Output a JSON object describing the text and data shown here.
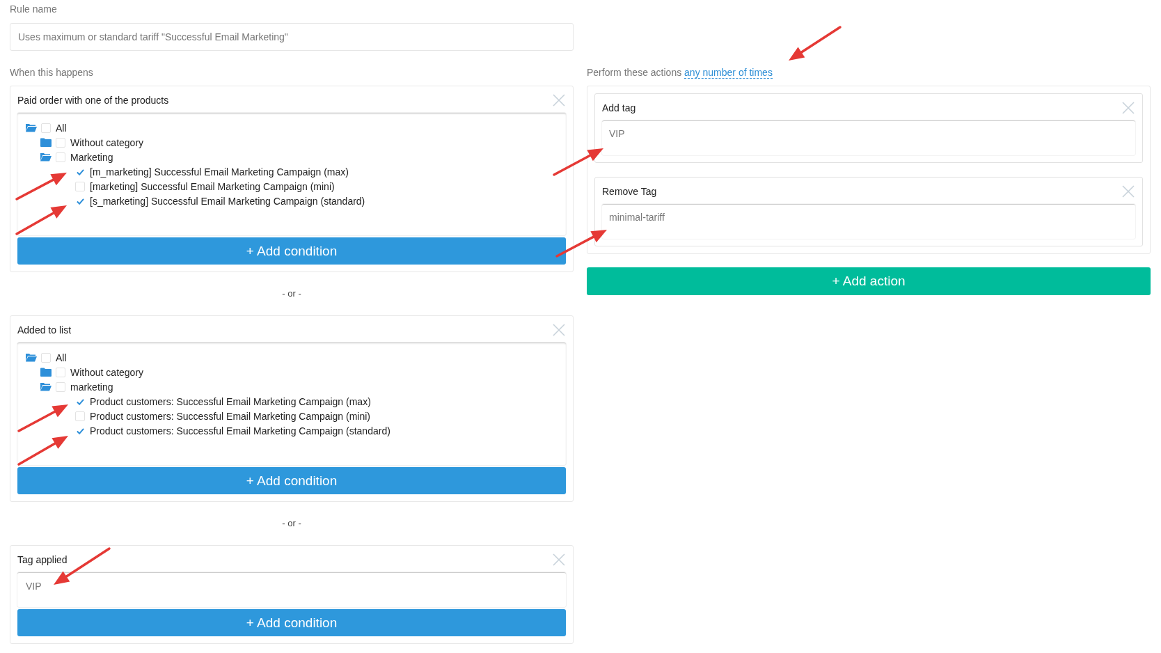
{
  "rule_name": {
    "label": "Rule name",
    "value": "Uses maximum or standard tariff \"Successful Email Marketing\""
  },
  "conditions": {
    "label": "When this happens",
    "items": [
      {
        "kind": "tree",
        "title": "Paid order with one of the products",
        "button": "+ Add condition",
        "tree": [
          {
            "kind": "folder",
            "label": "All",
            "checked": false,
            "expanded": true,
            "children": [
              {
                "kind": "folder",
                "label": "Without category",
                "checked": false,
                "expanded": false
              },
              {
                "kind": "folder",
                "label": "Marketing",
                "checked": false,
                "expanded": true,
                "children": [
                  {
                    "kind": "item",
                    "label": "[m_marketing] Successful Email Marketing Campaign (max)",
                    "checked": true
                  },
                  {
                    "kind": "item",
                    "label": "[marketing] Successful Email Marketing Campaign (mini)",
                    "checked": false
                  },
                  {
                    "kind": "item",
                    "label": "[s_marketing] Successful Email Marketing Campaign (standard)",
                    "checked": true
                  }
                ]
              }
            ]
          }
        ]
      },
      {
        "kind": "tree",
        "divider": "- or -",
        "title": "Added to list",
        "button": "+ Add condition",
        "tree": [
          {
            "kind": "folder",
            "label": "All",
            "checked": false,
            "expanded": true,
            "children": [
              {
                "kind": "folder",
                "label": "Without category",
                "checked": false,
                "expanded": false
              },
              {
                "kind": "folder",
                "label": "marketing",
                "checked": false,
                "expanded": true,
                "children": [
                  {
                    "kind": "item",
                    "label": "Product customers: Successful Email Marketing Campaign (max)",
                    "checked": true
                  },
                  {
                    "kind": "item",
                    "label": "Product customers: Successful Email Marketing Campaign (mini)",
                    "checked": false
                  },
                  {
                    "kind": "item",
                    "label": "Product customers: Successful Email Marketing Campaign (standard)",
                    "checked": true
                  }
                ]
              }
            ]
          }
        ]
      },
      {
        "kind": "tag",
        "divider": "- or -",
        "title": "Tag applied",
        "value": "VIP",
        "button": "+ Add condition"
      }
    ]
  },
  "actions": {
    "label": "Perform these actions",
    "link": "any number of times",
    "items": [
      {
        "title": "Add tag",
        "value": "VIP"
      },
      {
        "title": "Remove Tag",
        "value": "minimal-tariff"
      }
    ],
    "button": "+ Add action"
  }
}
